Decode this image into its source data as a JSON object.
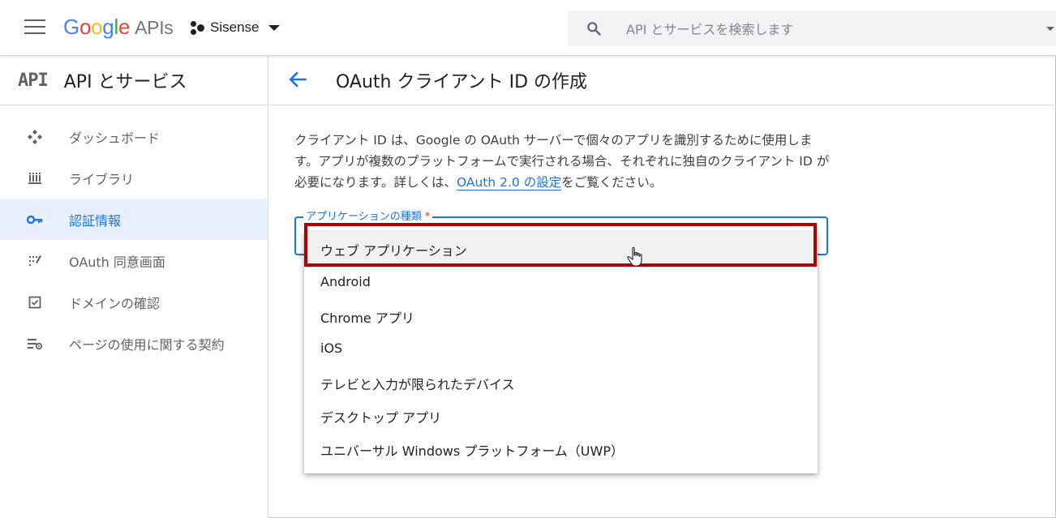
{
  "header": {
    "logo_letters": [
      "G",
      "o",
      "o",
      "g",
      "l",
      "e"
    ],
    "logo_suffix": "APIs",
    "project_name": "Sisense",
    "search_placeholder": "API とサービスを検索します"
  },
  "sidebar": {
    "badge": "API",
    "title": "API とサービス",
    "items": [
      {
        "label": "ダッシュボード",
        "icon": "dashboard-icon",
        "active": false
      },
      {
        "label": "ライブラリ",
        "icon": "library-icon",
        "active": false
      },
      {
        "label": "認証情報",
        "icon": "key-icon",
        "active": true
      },
      {
        "label": "OAuth 同意画面",
        "icon": "consent-icon",
        "active": false
      },
      {
        "label": "ドメインの確認",
        "icon": "checkbox-icon",
        "active": false
      },
      {
        "label": "ページの使用に関する契約",
        "icon": "settings-list-icon",
        "active": false
      }
    ]
  },
  "main": {
    "title": "OAuth クライアント ID の作成",
    "description_part1": "クライアント ID は、Google の OAuth サーバーで個々のアプリを識別するために使用します。アプリが複数のプラットフォームで実行される場合、それぞれに独自のクライアント ID が必要になります。詳しくは、",
    "description_link": "OAuth 2.0 の設定",
    "description_part2": "をご覧ください。",
    "field_label": "アプリケーションの種類",
    "required_mark": "*",
    "options": [
      "ウェブ アプリケーション",
      "Android",
      "Chrome アプリ",
      "iOS",
      "テレビと入力が限られたデバイス",
      "デスクトップ アプリ",
      "ユニバーサル Windows プラットフォーム（UWP）"
    ],
    "highlighted_option": 0
  },
  "colors": {
    "accent": "#1a73e8",
    "highlight_border": "#b00000",
    "active_bg": "#e8f0fe"
  }
}
